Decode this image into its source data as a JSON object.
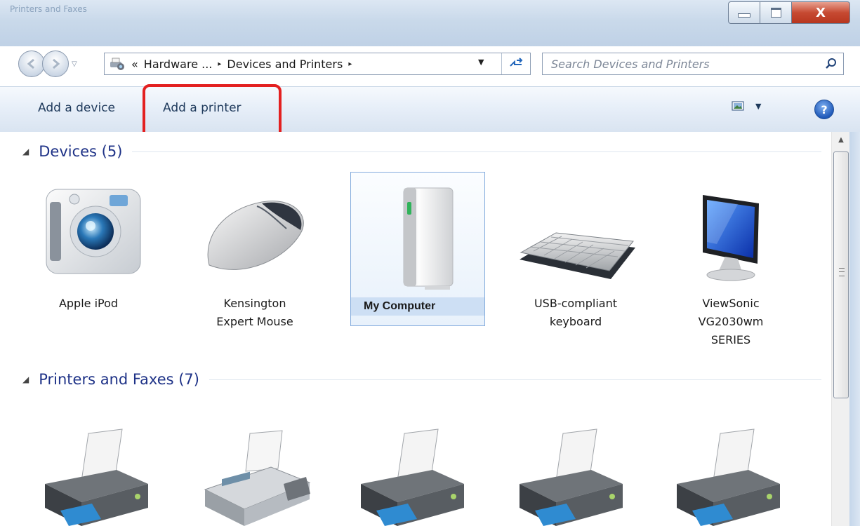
{
  "window": {
    "title": "Printers and Faxes"
  },
  "caption_buttons": {
    "close_glyph": "X"
  },
  "nav": {
    "back_icon": "back-arrow-icon",
    "forward_icon": "forward-arrow-icon"
  },
  "address_bar": {
    "overflow": "«",
    "crumb1": "Hardware ...",
    "separator": "▸",
    "crumb2": "Devices and Printers"
  },
  "search": {
    "placeholder": "Search Devices and Printers"
  },
  "toolbar": {
    "add_device": "Add a device",
    "add_printer": "Add a printer",
    "help_glyph": "?"
  },
  "groups": {
    "devices": {
      "title": "Devices (5)",
      "items": [
        {
          "label": "Apple iPod",
          "icon": "camera-icon"
        },
        {
          "label_lines": [
            "Kensington",
            "Expert Mouse"
          ],
          "icon": "mouse-icon"
        },
        {
          "label": "My Computer",
          "icon": "computer-tower-icon",
          "selected": true
        },
        {
          "label_lines": [
            "USB-compliant",
            "keyboard"
          ],
          "icon": "keyboard-icon"
        },
        {
          "label_lines": [
            "ViewSonic",
            "VG2030wm",
            "SERIES"
          ],
          "icon": "monitor-icon"
        }
      ]
    },
    "printers": {
      "title": "Printers and Faxes (7)",
      "items": [
        {
          "icon": "printer-icon"
        },
        {
          "icon": "fax-icon"
        },
        {
          "icon": "printer-icon"
        },
        {
          "icon": "printer-icon"
        },
        {
          "icon": "printer-icon"
        }
      ]
    }
  },
  "colors": {
    "highlight": "#e32020",
    "group_title": "#1e3287",
    "selection": "#cddff4"
  }
}
